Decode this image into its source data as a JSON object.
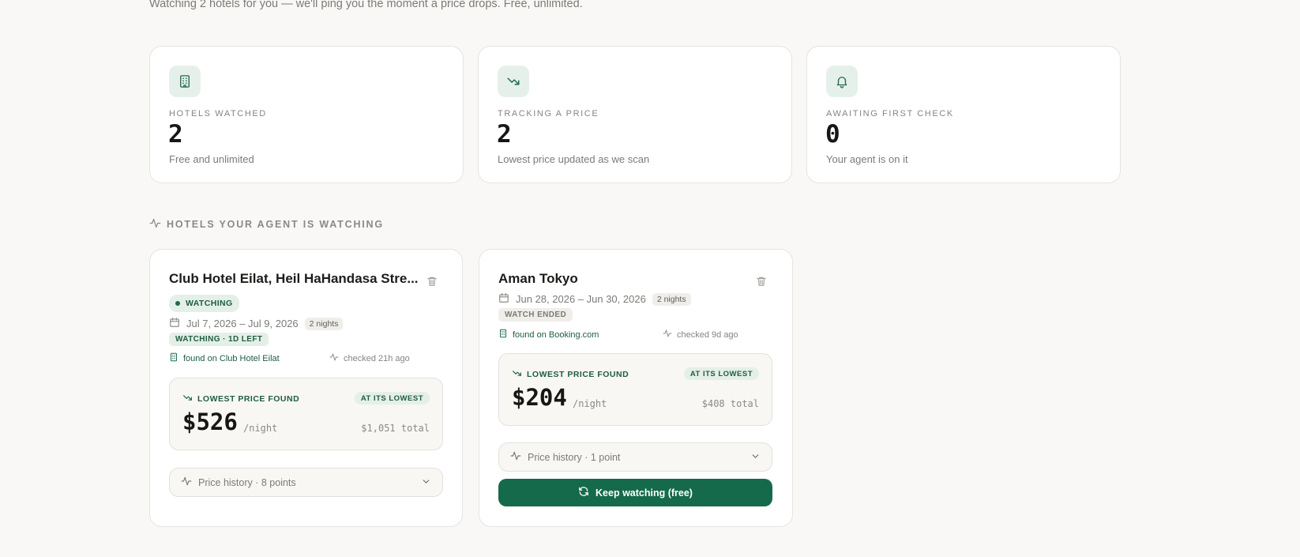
{
  "header": {
    "subtitle": "Watching 2 hotels for you — we'll ping you the moment a price drops. Free, unlimited."
  },
  "stats": [
    {
      "icon": "building-icon",
      "label": "HOTELS WATCHED",
      "value": "2",
      "sub": "Free and unlimited"
    },
    {
      "icon": "trending-down-icon",
      "label": "TRACKING A PRICE",
      "value": "2",
      "sub": "Lowest price updated as we scan"
    },
    {
      "icon": "bell-icon",
      "label": "AWAITING FIRST CHECK",
      "value": "0",
      "sub": "Your agent is on it"
    }
  ],
  "section": {
    "title": "HOTELS YOUR AGENT IS WATCHING"
  },
  "hotels": [
    {
      "name": "Club Hotel Eilat, Heil HaHandasa Stre...",
      "status": "WATCHING",
      "dates": "Jul 7, 2026 – Jul 9, 2026",
      "nights": "2 nights",
      "watch_status": "WATCHING · 1D LEFT",
      "source": "found on Club Hotel Eilat",
      "checked": "checked 21h ago",
      "price_label": "LOWEST PRICE FOUND",
      "badge": "AT ITS LOWEST",
      "price": "$526",
      "per_night": "/night",
      "total": "$1,051 total",
      "history": "Price history · 8 points"
    },
    {
      "name": "Aman Tokyo",
      "dates": "Jun 28, 2026 – Jun 30, 2026",
      "nights": "2 nights",
      "watch_status": "WATCH ENDED",
      "source": "found on Booking.com",
      "checked": "checked 9d ago",
      "price_label": "LOWEST PRICE FOUND",
      "badge": "AT ITS LOWEST",
      "price": "$204",
      "per_night": "/night",
      "total": "$408 total",
      "history": "Price history · 1 point",
      "action": "Keep watching (free)"
    }
  ],
  "colors": {
    "accent": "#156a4b",
    "accent_soft": "#e4efe8",
    "background": "#f9f8f6"
  }
}
